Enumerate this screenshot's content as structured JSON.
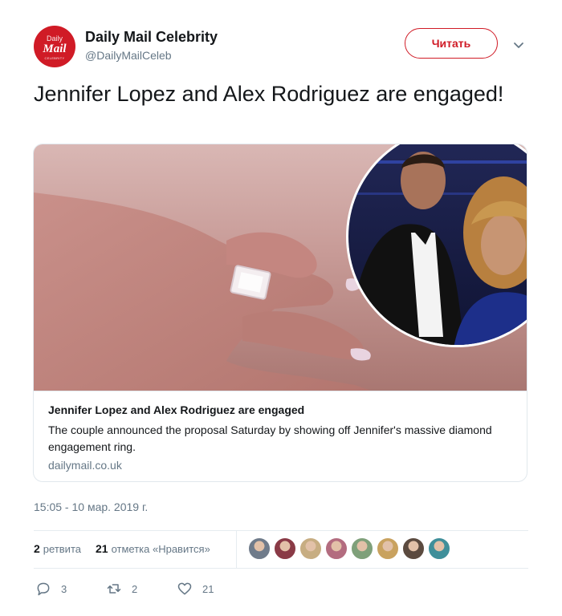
{
  "account": {
    "avatar_text_1": "Daily",
    "avatar_text_2": "Mail",
    "avatar_text_3": "CELEBRITY",
    "name": "Daily Mail Celebrity",
    "handle": "@DailyMailCeleb",
    "follow_label": "Читать",
    "menu_icon": "chevron-down-icon",
    "brand_color": "#d01b26"
  },
  "tweet": {
    "text": "Jennifer Lopez and Alex Rodriguez are engaged!",
    "timestamp": "15:05 - 10 мар. 2019 г."
  },
  "card": {
    "title": "Jennifer Lopez and Alex Rodriguez are engaged",
    "description": "The couple announced the proposal Saturday by showing off Jennifer's massive diamond engagement ring.",
    "domain": "dailymail.co.uk"
  },
  "stats": {
    "retweets_count": "2",
    "retweets_label": "ретвита",
    "likes_count": "21",
    "likes_label": "отметка «Нравится»"
  },
  "likers": [
    "#6f7b8a",
    "#8a3a46",
    "#c7ad82",
    "#b36c7f",
    "#7fa07a",
    "#c9a25f",
    "#5b4a3f",
    "#3f8f9a"
  ],
  "actions": {
    "reply_count": "3",
    "retweet_count": "2",
    "like_count": "21"
  }
}
